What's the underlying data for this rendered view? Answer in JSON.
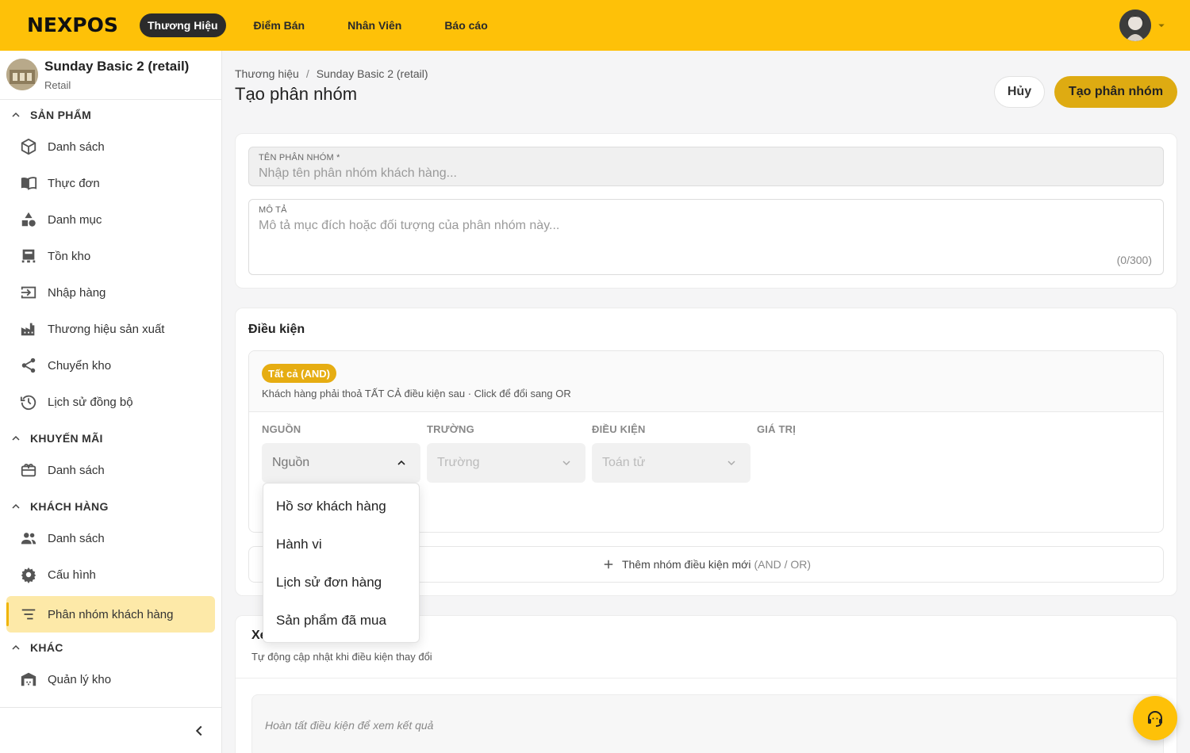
{
  "brand": {
    "logo_text": "NEXPOS",
    "accent": "#fec108"
  },
  "topnav": {
    "items": [
      {
        "label": "Thương Hiệu",
        "active": true
      },
      {
        "label": "Điểm Bán"
      },
      {
        "label": "Nhân Viên"
      },
      {
        "label": "Báo cáo"
      }
    ]
  },
  "store": {
    "name": "Sunday Basic 2 (retail)",
    "type": "Retail"
  },
  "sidebar": {
    "sections": [
      {
        "title": "SẢN PHẨM",
        "items": [
          {
            "label": "Danh sách",
            "icon": "cube-icon"
          },
          {
            "label": "Thực đơn",
            "icon": "menu-book-icon"
          },
          {
            "label": "Danh mục",
            "icon": "category-icon"
          },
          {
            "label": "Tồn kho",
            "icon": "warehouse-icon"
          },
          {
            "label": "Nhập hàng",
            "icon": "import-icon"
          },
          {
            "label": "Thương hiệu sản xuất",
            "icon": "factory-icon"
          },
          {
            "label": "Chuyển kho",
            "icon": "share-icon"
          },
          {
            "label": "Lịch sử đồng bộ",
            "icon": "history-icon"
          }
        ]
      },
      {
        "title": "KHUYẾN MÃI",
        "items": [
          {
            "label": "Danh sách",
            "icon": "gift-card-icon"
          }
        ]
      },
      {
        "title": "KHÁCH HÀNG",
        "items": [
          {
            "label": "Danh sách",
            "icon": "people-icon"
          },
          {
            "label": "Cấu hình",
            "icon": "gear-icon"
          },
          {
            "label": "Phân nhóm khách hàng",
            "icon": "filter-list-icon",
            "active": true
          }
        ]
      },
      {
        "title": "KHÁC",
        "items": [
          {
            "label": "Quản lý kho",
            "icon": "store-icon"
          }
        ]
      }
    ]
  },
  "breadcrumb": {
    "root": "Thương hiệu",
    "sep": "/",
    "current": "Sunday Basic 2 (retail)"
  },
  "page": {
    "title": "Tạo phân nhóm",
    "cancel_label": "Hủy",
    "create_label": "Tạo phân nhóm"
  },
  "form": {
    "name_label": "TÊN PHÂN NHÓM *",
    "name_placeholder": "Nhập tên phân nhóm khách hàng...",
    "desc_label": "MÔ TẢ",
    "desc_placeholder": "Mô tả mục đích hoặc đối tượng của phân nhóm này...",
    "desc_counter": "(0/300)"
  },
  "conditions": {
    "title": "Điều kiện",
    "badge": "Tất cả (AND)",
    "desc": "Khách hàng phải thoả TẤT CẢ điều kiện sau · Click để đổi sang OR",
    "columns": [
      "NGUỒN",
      "TRƯỜNG",
      "ĐIỀU KIỆN",
      "GIÁ TRỊ"
    ],
    "source_placeholder": "Nguồn",
    "field_placeholder": "Trường",
    "operator_placeholder": "Toán tử",
    "add_group_label": "Thêm nhóm điều kiện mới",
    "add_group_hint": "(AND / OR)"
  },
  "dropdown": {
    "options": [
      "Hồ sơ khách hàng",
      "Hành vi",
      "Lịch sử đơn hàng",
      "Sản phẩm đã mua"
    ]
  },
  "preview": {
    "title": "Xe",
    "subtitle": "Tự động cập nhật khi điều kiện thay đổi",
    "empty_text": "Hoàn tất điều kiện để xem kết quả"
  }
}
